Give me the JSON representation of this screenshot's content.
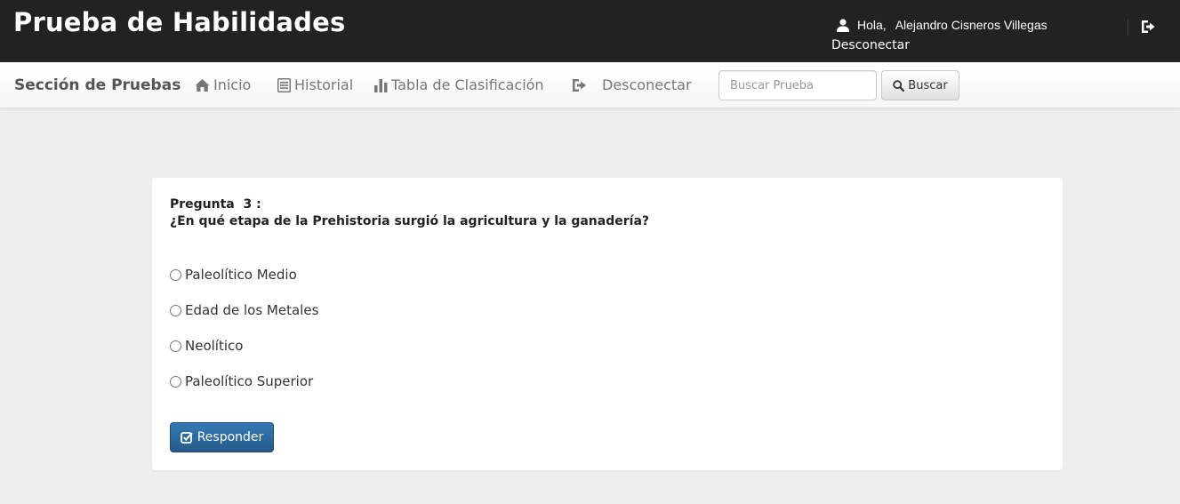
{
  "header": {
    "app_title": "Prueba de Habilidades",
    "greeting": "Hola,",
    "user_name": "Alejandro Cisneros Villegas",
    "logout_label": "Desconectar",
    "icons": {
      "user": "user-icon",
      "logout": "logout-icon"
    }
  },
  "navbar": {
    "brand": "Sección de Pruebas",
    "items": [
      {
        "label": "Inicio",
        "icon": "home-icon"
      },
      {
        "label": "Historial",
        "icon": "list-icon"
      },
      {
        "label": "Tabla de Clasificación",
        "icon": "bar-chart-icon"
      },
      {
        "label": "Desconectar",
        "icon": "logout-icon"
      }
    ],
    "search": {
      "placeholder": "Buscar Prueba",
      "value": "",
      "button_label": "Buscar",
      "button_icon": "search-icon"
    }
  },
  "question": {
    "number_label": "Pregunta  3 :",
    "text": "¿En qué etapa de la Prehistoria surgió la agricultura y la ganadería?",
    "options": [
      {
        "label": "Paleolítico Medio",
        "selected": false
      },
      {
        "label": "Edad de los Metales",
        "selected": false
      },
      {
        "label": "Neolítico",
        "selected": false
      },
      {
        "label": "Paleolítico Superior",
        "selected": false
      }
    ],
    "submit_label": "Responder",
    "submit_icon": "check-square-icon"
  },
  "colors": {
    "header_bg": "#222222",
    "page_bg": "#eeeeee",
    "primary": "#337ab7"
  }
}
